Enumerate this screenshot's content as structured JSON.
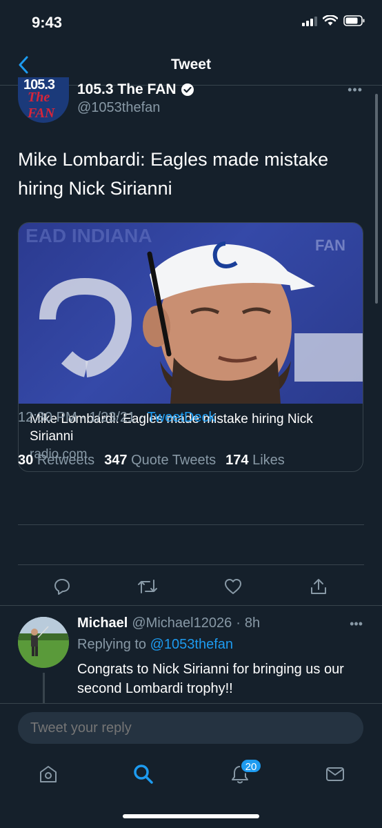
{
  "status_bar": {
    "time": "9:43"
  },
  "nav": {
    "title": "Tweet"
  },
  "tweet": {
    "account_name": "105.3 The FAN",
    "handle": "@1053thefan",
    "avatar_text_top": "105.3",
    "avatar_text_bottom": "The FAN",
    "text": "Mike Lombardi: Eagles made mistake hiring Nick Sirianni",
    "card": {
      "title": "Mike Lombardi: Eagles made mistake hiring Nick Sirianni",
      "domain": "radio.com"
    },
    "time": "12:30 PM",
    "date": "1/23/21",
    "source": "TweetDeck",
    "stats": {
      "retweets_count": "30",
      "retweets_label": "Retweets",
      "quotes_count": "347",
      "quotes_label": "Quote Tweets",
      "likes_count": "174",
      "likes_label": "Likes"
    }
  },
  "reply": {
    "name": "Michael",
    "handle": "@Michael12026",
    "age": "8h",
    "replying_label": "Replying to",
    "replying_to": "@1053thefan",
    "text": "Congrats to Nick Sirianni for bringing us our second Lombardi trophy!!"
  },
  "compose": {
    "placeholder": "Tweet your reply"
  },
  "tab_bar": {
    "notifications_badge": "20"
  },
  "colors": {
    "background": "#15202b",
    "accent": "#1d9bf0",
    "muted": "#8899a6",
    "divider": "#38444d"
  }
}
